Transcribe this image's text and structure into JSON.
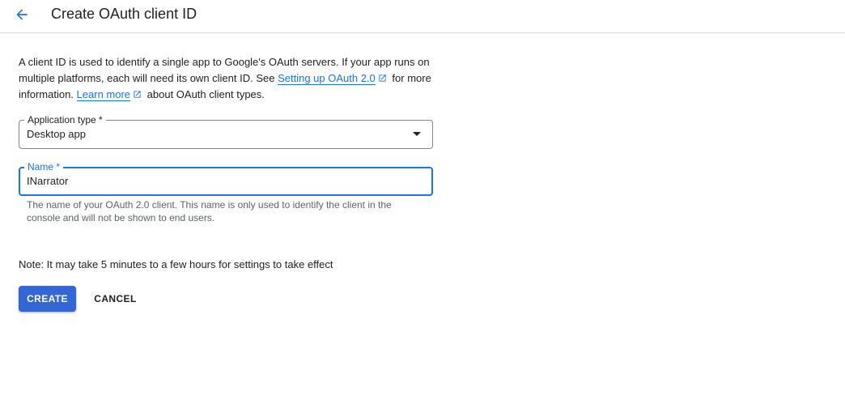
{
  "header": {
    "title": "Create OAuth client ID"
  },
  "intro": {
    "text1": "A client ID is used to identify a single app to Google's OAuth servers. If your app runs on multiple platforms, each will need its own client ID. See ",
    "link1": "Setting up OAuth 2.0",
    "text2": " for more information. ",
    "link2": "Learn more",
    "text3": " about OAuth client types."
  },
  "form": {
    "application_type": {
      "label": "Application type *",
      "value": "Desktop app"
    },
    "name": {
      "label": "Name *",
      "value": "INarrator",
      "hint": "The name of your OAuth 2.0 client. This name is only used to identify the client in the console and will not be shown to end users."
    }
  },
  "note": "Note: It may take 5 minutes to a few hours for settings to take effect",
  "actions": {
    "create_label": "CREATE",
    "cancel_label": "CANCEL"
  },
  "colors": {
    "accent": "#1a73e8",
    "primary_button": "#3367d6"
  },
  "icons": {
    "back": "arrow-back-icon",
    "external": "open-in-new-icon",
    "dropdown": "caret-down-icon"
  }
}
